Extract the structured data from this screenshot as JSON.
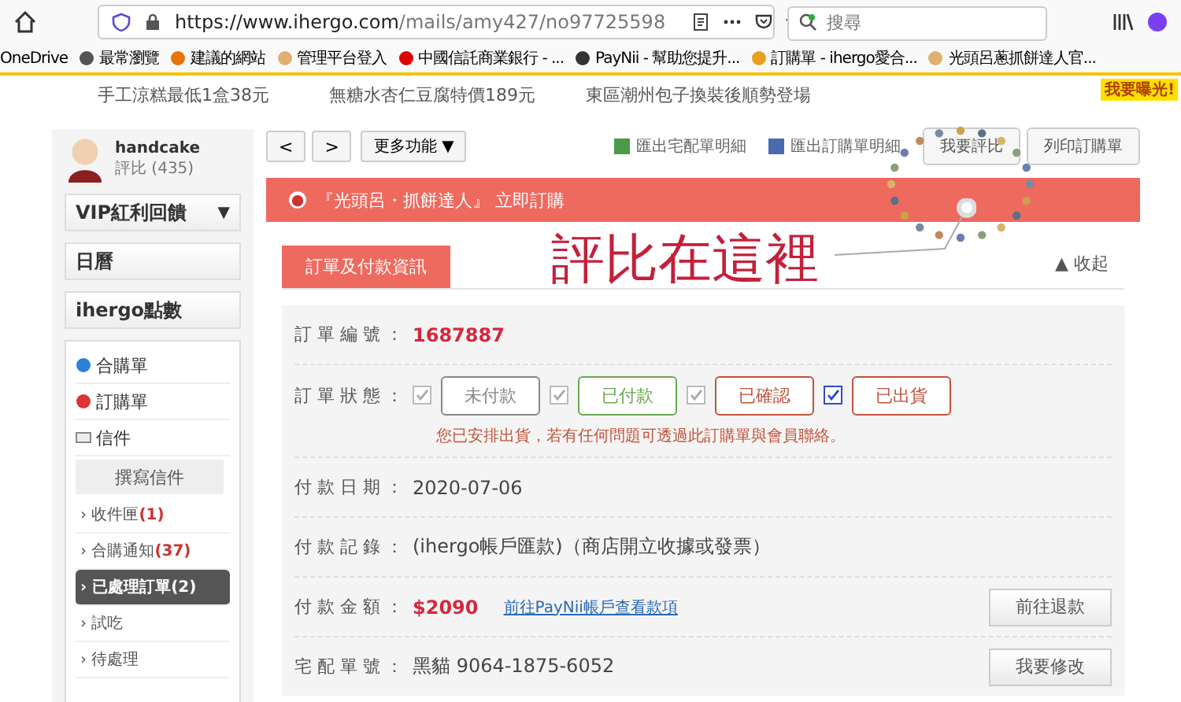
{
  "browser": {
    "url_host": "https://www.ihergo.com",
    "url_path": "/mails/amy427/no97725598",
    "search": {
      "placeholder": "搜尋"
    },
    "bookmarks": [
      {
        "label": "OneDrive",
        "kind": "none"
      },
      {
        "label": "最常瀏覽",
        "kind": "gear"
      },
      {
        "label": "建議的網站",
        "kind": "bulb"
      },
      {
        "label": "管理平台登入",
        "kind": "face"
      },
      {
        "label": "中國信託商業銀行 - ...",
        "kind": "bank"
      },
      {
        "label": "PayNii - 幫助您提升...",
        "kind": "ring"
      },
      {
        "label": "訂購單 - ihergo愛合...",
        "kind": "box"
      },
      {
        "label": "光頭呂蔥抓餅達人官...",
        "kind": "face"
      }
    ]
  },
  "promos": [
    "手工涼糕最低1盒38元",
    "無糖水杏仁豆腐特價189元",
    "東區潮州包子換裝後順勢登場"
  ],
  "promo_badge": "我要曝光!",
  "sidebar": {
    "user": {
      "name": "handcake",
      "rating": "評比 (435)"
    },
    "buttons": [
      {
        "label": "VIP紅利回饋",
        "caret": "▼"
      },
      {
        "label": "日曆"
      },
      {
        "label": "ihergo點數"
      }
    ],
    "menu": [
      {
        "label": "合購單",
        "kind": "globe"
      },
      {
        "label": "訂購單",
        "kind": "bus"
      },
      {
        "label": "信件",
        "kind": "mail"
      }
    ],
    "compose": "撰寫信件",
    "folders": [
      {
        "chevron": "›",
        "label": "收件匣",
        "count": "(1)",
        "selected": false
      },
      {
        "chevron": "›",
        "label": "合購通知",
        "count": "(37)",
        "selected": false
      },
      {
        "chevron": "›",
        "label": "已處理訂單",
        "count": "(2)",
        "selected": true
      },
      {
        "chevron": "›",
        "label": "試吃",
        "selected": false
      },
      {
        "chevron": "›",
        "label": "待處理",
        "selected": false
      }
    ]
  },
  "toolbar": {
    "prev": "<",
    "next": ">",
    "more": "更多功能 ▼",
    "export_delivery": "匯出宅配單明細",
    "export_order": "匯出訂購單明細",
    "rate": "我要評比",
    "print": "列印訂購單"
  },
  "banner": "『光頭呂・抓餅達人』 立即訂購",
  "annotation": "評比在這裡",
  "section_tab": "訂單及付款資訊",
  "collapse": "▲ 收起",
  "order": {
    "number_label": "訂 單 編 號 ：",
    "number": "1687887",
    "status_label": "訂 單 狀 態 ：",
    "statuses": [
      {
        "label": "未付款",
        "checked": true,
        "disabled": true,
        "color": "#888888"
      },
      {
        "label": "已付款",
        "checked": true,
        "disabled": true,
        "color": "#6aa84f"
      },
      {
        "label": "已確認",
        "checked": true,
        "disabled": true,
        "color": "#c0533a"
      },
      {
        "label": "已出貨",
        "checked": true,
        "disabled": false,
        "color": "#c0533a"
      }
    ],
    "status_note": "您已安排出貨，若有任何問題可透過此訂購單與會員聯絡。",
    "date_label": "付 款 日 期 ：",
    "date": "2020-07-06",
    "record_label": "付 款 記 錄 ：",
    "record": "(ihergo帳戶匯款)（商店開立收據或發票）",
    "amount_label": "付 款 金 額 ：",
    "amount": "$2090",
    "amount_link": "前往PayNii帳戶查看款項",
    "refund": "前往退款",
    "delivery_label": "宅 配 單 號 ：",
    "delivery": "黑貓 9064-1875-6052",
    "edit": "我要修改"
  }
}
